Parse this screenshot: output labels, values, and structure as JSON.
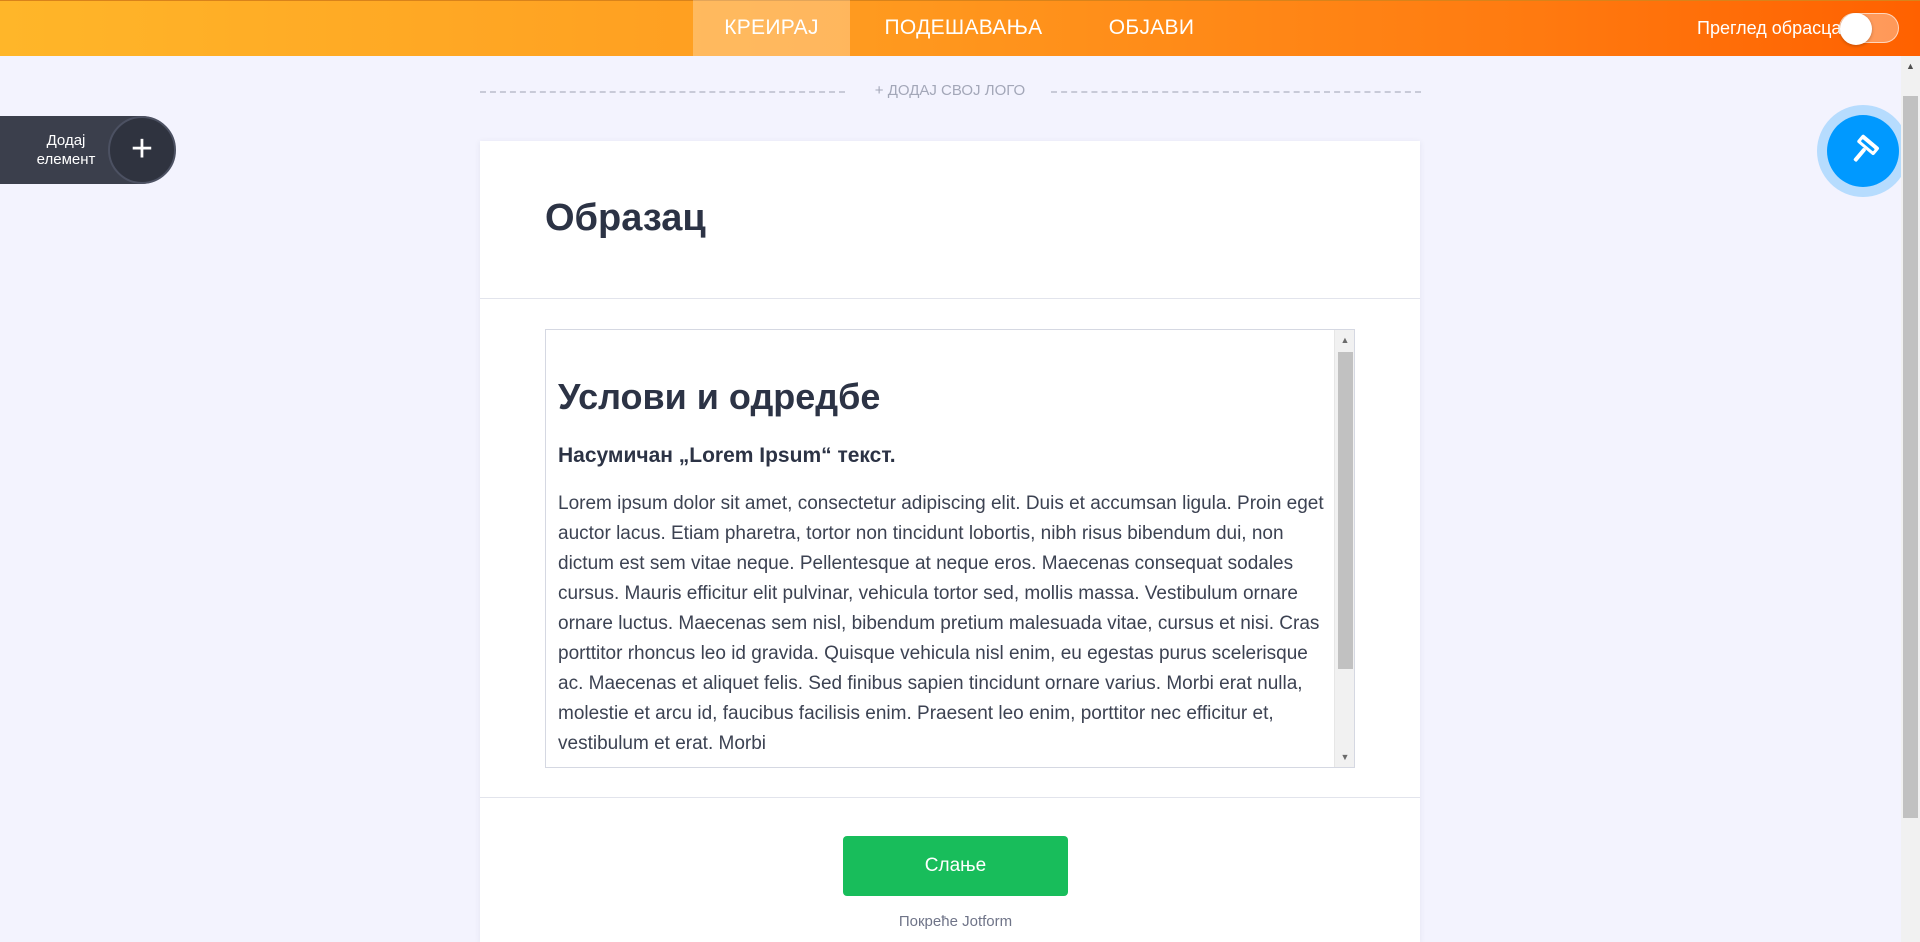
{
  "header": {
    "tabs": [
      {
        "label": "КРЕИРАЈ",
        "active": true
      },
      {
        "label": "ПОДЕШАВАЊА",
        "active": false
      },
      {
        "label": "ОБЈАВИ",
        "active": false
      }
    ],
    "preview_label": "Преглед обрасца",
    "preview_enabled": false
  },
  "logo": {
    "add_label": "+ ДОДАЈ СВОЈ ЛОГО"
  },
  "add_element": {
    "label": "Додај елемент",
    "icon": "plus-icon"
  },
  "form": {
    "title": "Образац",
    "terms": {
      "heading": "Услови и одредбе",
      "subheading": "Насумичан „Lorem Ipsum“ текст.",
      "paragraph": "Lorem ipsum dolor sit amet, consectetur adipiscing elit. Duis et accumsan ligula. Proin eget auctor lacus. Etiam pharetra, tortor non tincidunt lobortis, nibh risus bibendum dui, non dictum est sem vitae neque. Pellentesque at neque eros. Maecenas consequat sodales cursus. Mauris efficitur elit pulvinar, vehicula tortor sed, mollis massa. Vestibulum ornare ornare luctus. Maecenas sem nisl, bibendum pretium malesuada vitae, cursus et nisi. Cras porttitor rhoncus leo id gravida. Quisque vehicula nisl enim, eu egestas purus scelerisque ac. Maecenas et aliquet felis. Sed finibus sapien tincidunt ornare varius. Morbi erat nulla, molestie et arcu id, faucibus facilisis enim. Praesent leo enim, porttitor nec efficitur et, vestibulum et erat. Morbi"
    },
    "submit_label": "Слање",
    "powered_by": "Покреће Jotform"
  },
  "designer_button": {
    "icon": "paint-roller-icon"
  },
  "colors": {
    "accent_orange": "#ff7a10",
    "submit_green": "#18bd5b",
    "designer_blue": "#0099ff",
    "page_bg": "#f3f3fe"
  }
}
